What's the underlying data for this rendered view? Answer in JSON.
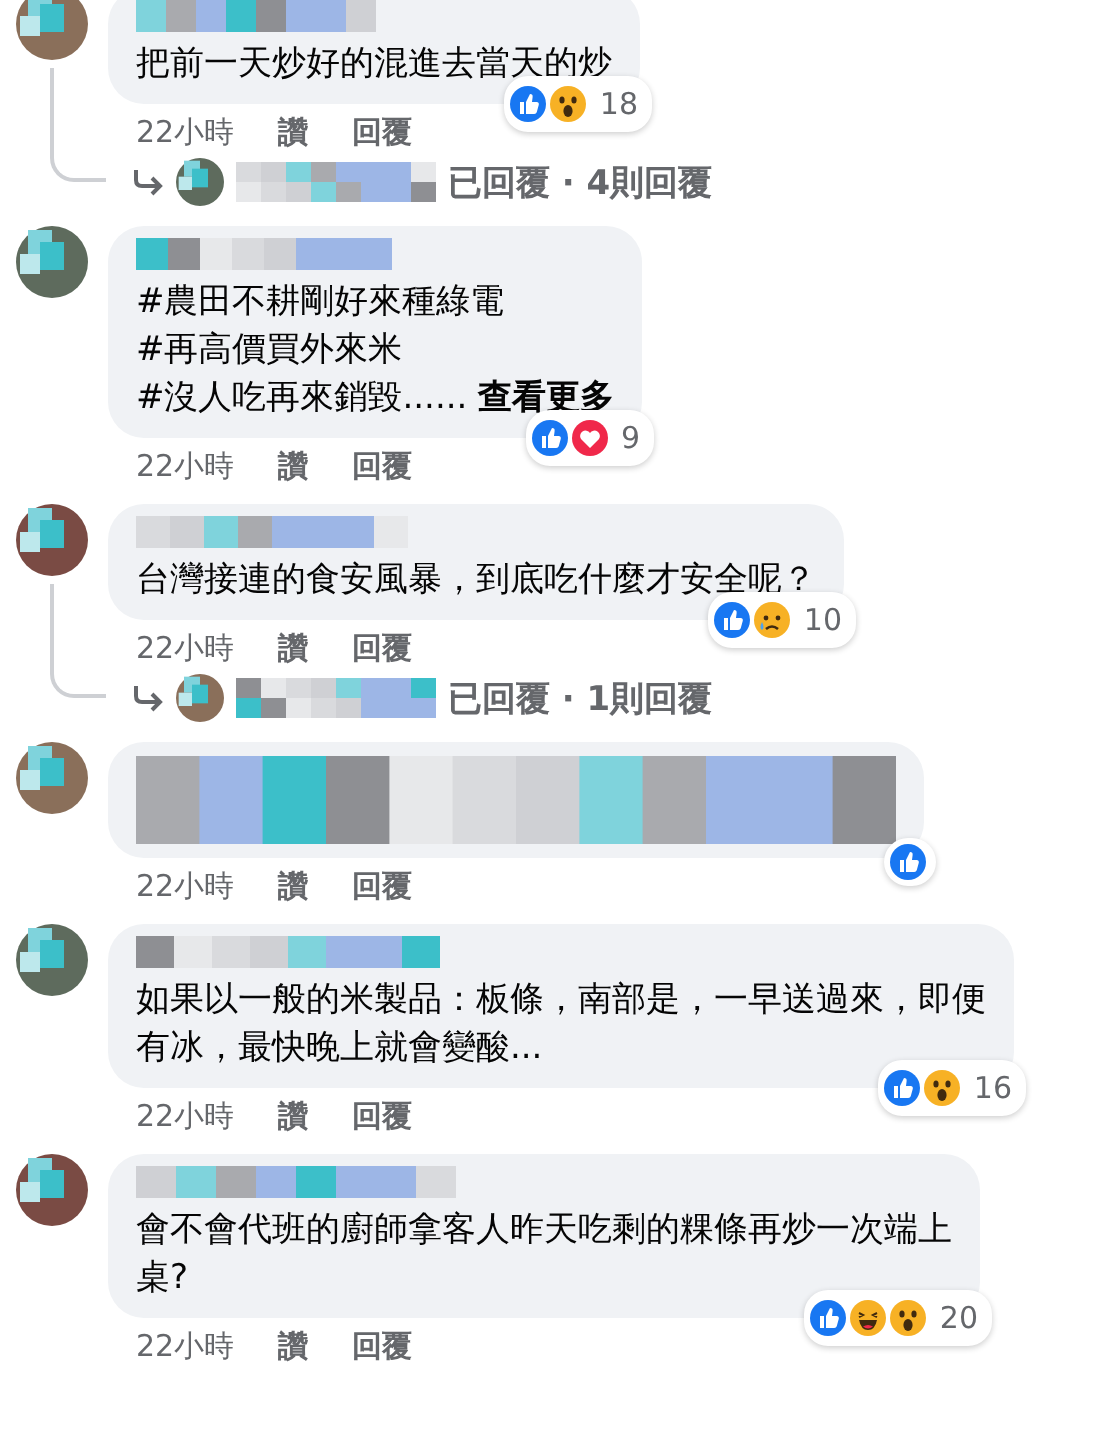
{
  "comments": [
    {
      "lines": [
        "把前一天炒好的混進去當天的炒"
      ],
      "reactions": [
        {
          "kind": "like"
        },
        {
          "kind": "wow"
        }
      ],
      "count": "18",
      "time": "22小時",
      "like": "讚",
      "reply": "回覆",
      "replies": "已回覆 · 4則回覆"
    },
    {
      "lines": [
        "#農田不耕剛好來種綠電",
        "#再高價買外來米",
        "#沒人吃再來銷毀...... **查看更多**"
      ],
      "reactions": [
        {
          "kind": "like"
        },
        {
          "kind": "love"
        }
      ],
      "count": "9",
      "time": "22小時",
      "like": "讚",
      "reply": "回覆"
    },
    {
      "lines": [
        "台灣接連的食安風暴，到底吃什麼才安全呢？"
      ],
      "reactions": [
        {
          "kind": "like"
        },
        {
          "kind": "sad"
        }
      ],
      "count": "10",
      "time": "22小時",
      "like": "讚",
      "reply": "回覆",
      "replies": "已回覆 · 1則回覆"
    },
    {
      "kind": "hidden",
      "reactions": [
        {
          "kind": "like"
        }
      ],
      "time": "22小時",
      "like": "讚",
      "reply": "回覆"
    },
    {
      "lines": [
        "如果以一般的米製品：板條，南部是，一早送過來，即便",
        "有冰，最快晚上就會變酸..."
      ],
      "reactions": [
        {
          "kind": "like"
        },
        {
          "kind": "wow"
        }
      ],
      "count": "16",
      "time": "22小時",
      "like": "讚",
      "reply": "回覆"
    },
    {
      "lines": [
        "會不會代班的廚師拿客人昨天吃剩的粿條再炒一次端上",
        "桌?"
      ],
      "reactions": [
        {
          "kind": "like"
        },
        {
          "kind": "haha"
        },
        {
          "kind": "wow"
        }
      ],
      "count": "20",
      "time": "22小時",
      "like": "讚",
      "reply": "回覆"
    }
  ]
}
